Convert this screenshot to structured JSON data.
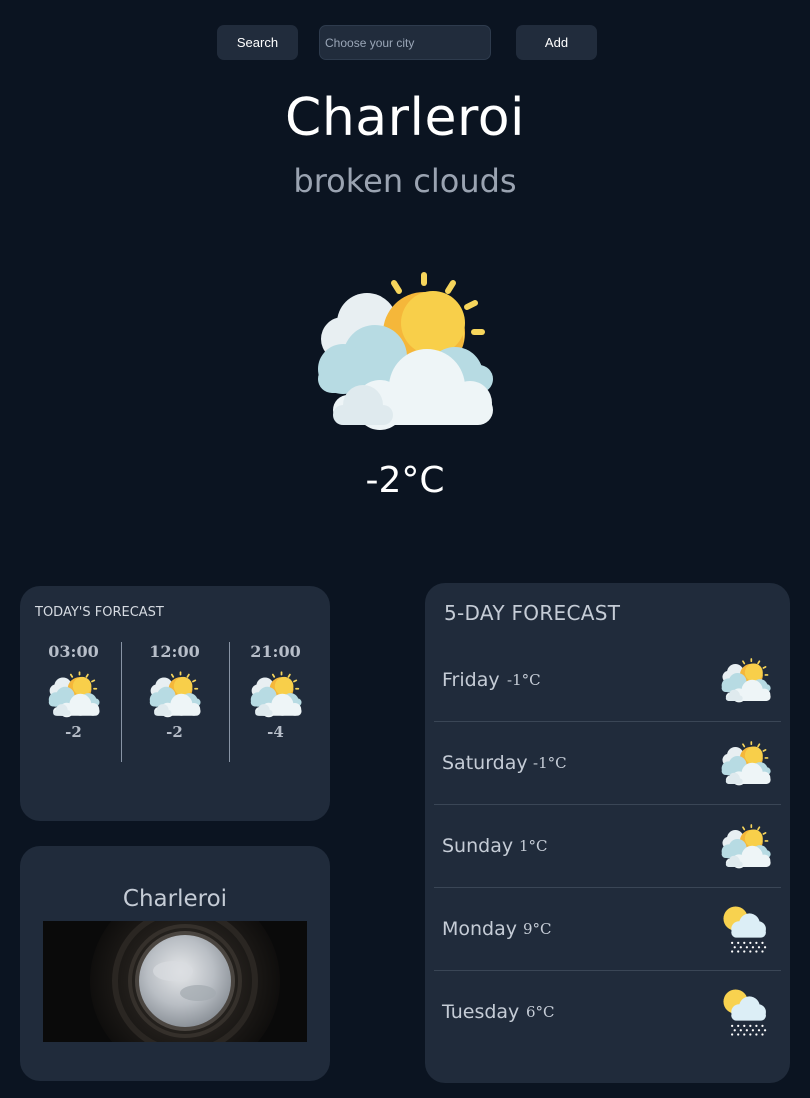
{
  "search": {
    "button_label": "Search",
    "placeholder": "Choose your city",
    "add_label": "Add"
  },
  "current": {
    "city": "Charleroi",
    "condition": "broken clouds",
    "temperature": "-2°C",
    "icon": "sun-behind-clouds-icon"
  },
  "today": {
    "title": "TODAY'S FORECAST",
    "hours": [
      {
        "time": "03:00",
        "temp": "-2",
        "icon": "sun-behind-clouds-icon"
      },
      {
        "time": "12:00",
        "temp": "-2",
        "icon": "sun-behind-clouds-icon"
      },
      {
        "time": "21:00",
        "temp": "-4",
        "icon": "sun-behind-clouds-icon"
      }
    ]
  },
  "photo": {
    "city": "Charleroi"
  },
  "five_day": {
    "title": "5-DAY FORECAST",
    "days": [
      {
        "day": "Friday",
        "temp": "-1°C",
        "icon": "sun-behind-clouds-icon"
      },
      {
        "day": "Saturday",
        "temp": "-1°C",
        "icon": "sun-behind-clouds-icon"
      },
      {
        "day": "Sunday",
        "temp": "1°C",
        "icon": "sun-behind-clouds-icon"
      },
      {
        "day": "Monday",
        "temp": "9°C",
        "icon": "snow-cloud-icon"
      },
      {
        "day": "Tuesday",
        "temp": "6°C",
        "icon": "snow-cloud-icon"
      }
    ]
  },
  "colors": {
    "background": "#0b1421",
    "card": "#202b3b",
    "sun": "#f5b73a",
    "cloud": "#b9dde5"
  }
}
